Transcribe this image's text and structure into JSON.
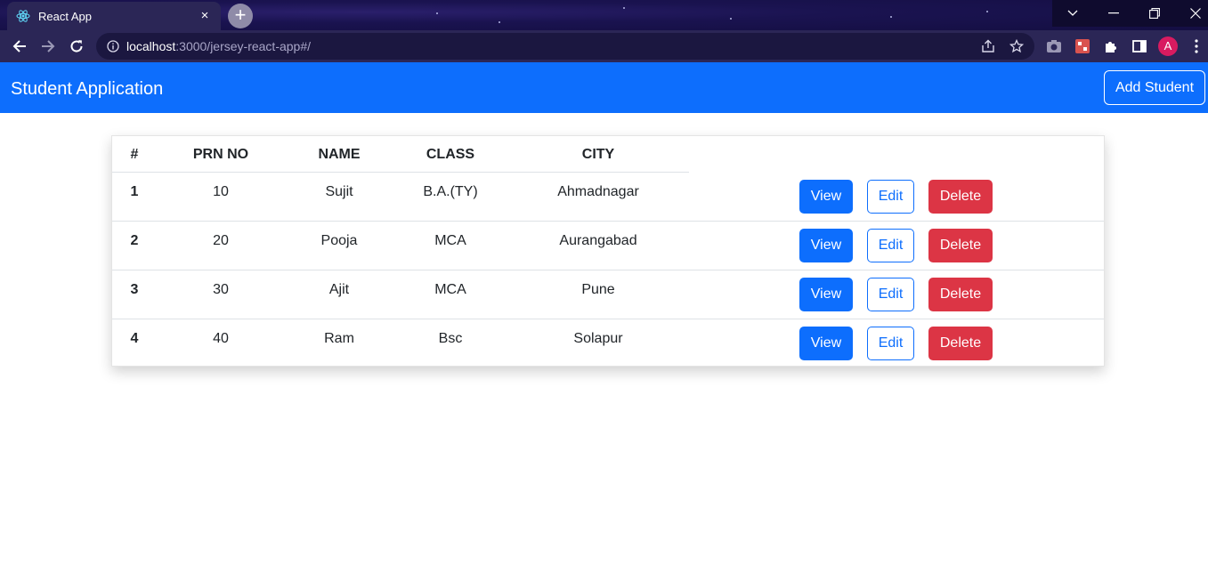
{
  "browser": {
    "tab_title": "React App",
    "tab_close": "×",
    "new_tab": "+",
    "url_host": "localhost",
    "url_rest": ":3000/jersey-react-app#/",
    "profile_initial": "A",
    "icons": {
      "favicon": "react-logo-icon",
      "back": "back-arrow-icon",
      "forward": "forward-arrow-icon",
      "reload": "reload-icon",
      "site_info": "info-icon",
      "share": "share-icon",
      "bookmark": "star-icon",
      "camera_extension": "camera-icon",
      "red_extension": "extension-red-icon",
      "extensions": "puzzle-icon",
      "side_panel": "side-panel-icon",
      "menu": "kebab-menu-icon",
      "tab_search": "chevron-down-icon",
      "minimize": "minimize-icon",
      "restore": "restore-icon",
      "close": "close-icon"
    }
  },
  "app": {
    "brand": "Student Application",
    "add_button": "Add Student",
    "colors": {
      "primary": "#0d6efd",
      "danger": "#dc3545"
    }
  },
  "table": {
    "headers": {
      "index": "#",
      "prn": "PRN NO",
      "name": "NAME",
      "class": "CLASS",
      "city": "CITY"
    },
    "rows": [
      {
        "index": "1",
        "prn": "10",
        "name": "Sujit",
        "class": "B.A.(TY)",
        "city": "Ahmadnagar"
      },
      {
        "index": "2",
        "prn": "20",
        "name": "Pooja",
        "class": "MCA",
        "city": "Aurangabad"
      },
      {
        "index": "3",
        "prn": "30",
        "name": "Ajit",
        "class": "MCA",
        "city": "Pune"
      },
      {
        "index": "4",
        "prn": "40",
        "name": "Ram",
        "class": "Bsc",
        "city": "Solapur"
      }
    ],
    "actions": {
      "view": "View",
      "edit": "Edit",
      "delete": "Delete"
    }
  }
}
